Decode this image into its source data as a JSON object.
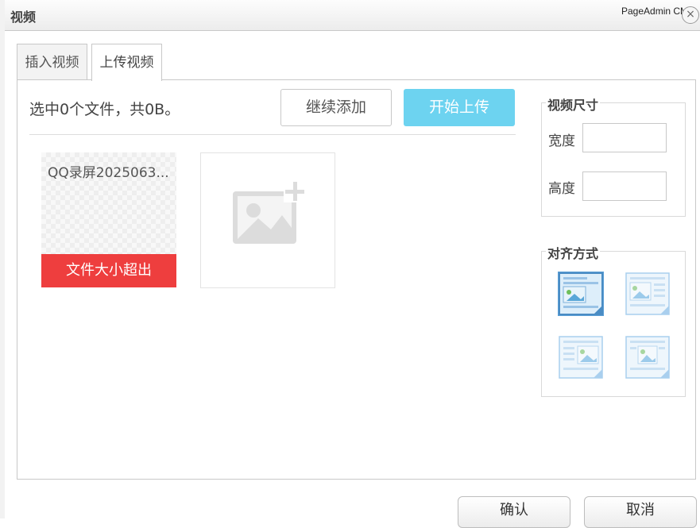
{
  "window": {
    "title": "视频",
    "brand": "PageAdmin CMS",
    "close_glyph": "×"
  },
  "tabs": [
    {
      "label": "插入视频",
      "active": false
    },
    {
      "label": "上传视频",
      "active": true
    }
  ],
  "upload": {
    "status": "选中0个文件，共0B。",
    "add_button": "继续添加",
    "start_button": "开始上传",
    "start_button_color": "#6dd3f0",
    "files": [
      {
        "name": "QQ录屏2025063...",
        "error": "文件大小超出",
        "error_color": "#ee3e3e"
      }
    ],
    "add_card_icon": "add-image-icon"
  },
  "size": {
    "legend": "视频尺寸",
    "width_label": "宽度",
    "width_value": "",
    "height_label": "高度",
    "height_value": ""
  },
  "alignment": {
    "legend": "对齐方式",
    "options": [
      {
        "icon": "align-none-icon",
        "selected": true
      },
      {
        "icon": "align-left-icon",
        "selected": false
      },
      {
        "icon": "align-right-icon",
        "selected": false
      },
      {
        "icon": "align-center-icon",
        "selected": false
      }
    ]
  },
  "footer": {
    "ok": "确认",
    "cancel": "取消"
  }
}
